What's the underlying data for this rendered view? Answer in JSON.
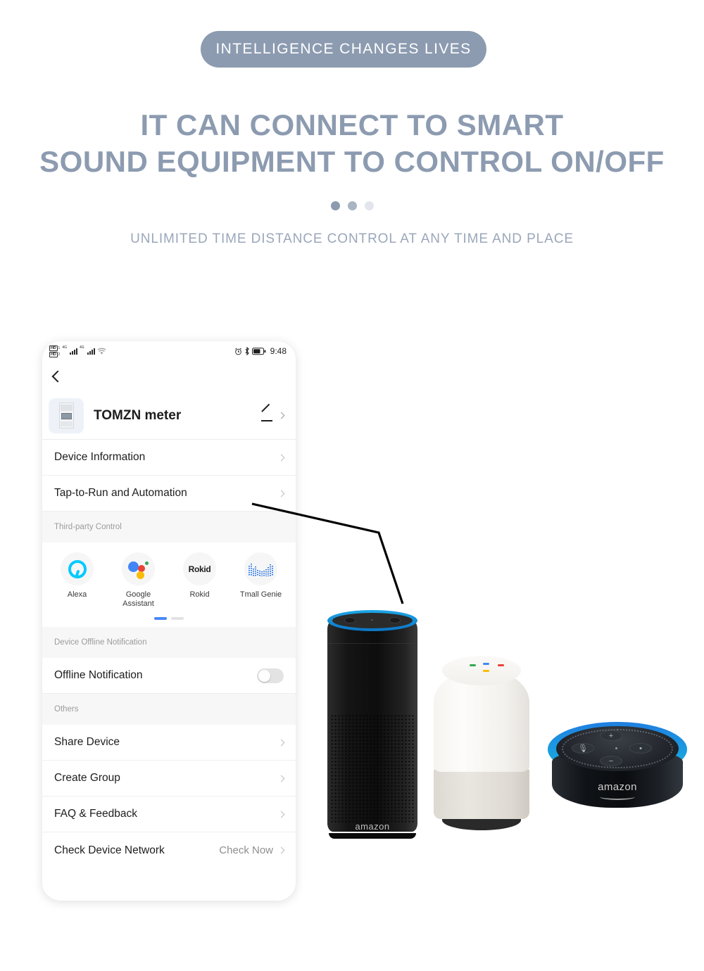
{
  "hero": {
    "badge": "INTELLIGENCE CHANGES LIVES",
    "headline_line1": "IT CAN CONNECT TO SMART",
    "headline_line2": "SOUND EQUIPMENT TO CONTROL ON/OFF",
    "subhead": "UNLIMITED TIME DISTANCE CONTROL AT ANY TIME AND PLACE",
    "dots": [
      "#8c9bb0",
      "#aab5c4",
      "#e2e6ec"
    ],
    "accent_color": "#8c9bb0"
  },
  "phone": {
    "status_bar": {
      "network_badge_1": "HD",
      "network_badge_1_sub": "1",
      "network_badge_2": "HD",
      "network_badge_2_sub": "2",
      "gen_label_1": "4G",
      "gen_label_2": "4G",
      "wifi_icon": "wifi-icon",
      "alarm_icon": "alarm-clock-icon",
      "bluetooth_icon": "bluetooth-icon",
      "battery_icon": "battery-icon",
      "time": "9:48"
    },
    "nav": {
      "back_icon": "back-chevron-icon"
    },
    "device": {
      "thumbnail_icon": "din-rail-energy-meter-thumbnail",
      "name": "TOMZN meter",
      "edit_icon": "pencil-edit-icon",
      "chevron_icon": "chevron-right-icon"
    },
    "menu_top": [
      {
        "label": "Device Information",
        "chevron": "chevron-right-icon"
      },
      {
        "label": "Tap-to-Run and Automation",
        "chevron": "chevron-right-icon"
      }
    ],
    "third_party": {
      "section_title": "Third-party Control",
      "items": [
        {
          "label": "Alexa",
          "icon": "alexa-icon"
        },
        {
          "label": "Google\nAssistant",
          "label_l1": "Google",
          "label_l2": "Assistant",
          "icon": "google-assistant-icon"
        },
        {
          "label": "Rokid",
          "icon": "rokid-icon",
          "wordmark": "Rokid"
        },
        {
          "label": "Tmall Genie",
          "icon": "tmall-genie-icon"
        }
      ],
      "pager": {
        "active_color": "#4a8af4",
        "inactive_color": "#e3e3e3",
        "pages": 2,
        "active_index": 0
      }
    },
    "offline": {
      "section_title": "Device Offline Notification",
      "row_label": "Offline Notification",
      "toggle_state": "off"
    },
    "others": {
      "section_title": "Others",
      "rows": [
        {
          "label": "Share Device",
          "value": "",
          "chevron": "chevron-right-icon"
        },
        {
          "label": "Create Group",
          "value": "",
          "chevron": "chevron-right-icon"
        },
        {
          "label": "FAQ & Feedback",
          "value": "",
          "chevron": "chevron-right-icon"
        },
        {
          "label": "Check Device Network",
          "value": "Check Now",
          "chevron": "chevron-right-icon"
        }
      ]
    }
  },
  "speakers": [
    {
      "name": "amazon-echo-speaker",
      "wordmark": "amazon",
      "ring_color": "#1ea7e6"
    },
    {
      "name": "google-home-speaker",
      "led_colors": [
        "#34a853",
        "#4285f4",
        "#ea4335",
        "#fbbc05"
      ]
    },
    {
      "name": "amazon-echo-dot-speaker",
      "wordmark": "amazon",
      "ring_color": "#1f7fe0"
    }
  ],
  "pointer": {
    "name": "callout-line",
    "color": "#000000"
  }
}
